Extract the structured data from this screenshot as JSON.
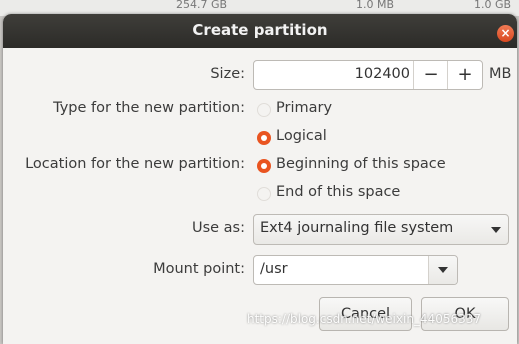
{
  "background": {
    "partition_size": "254.7 GB",
    "free_space": "1.0 MB",
    "right_text": "1.0 GB"
  },
  "dialog": {
    "title": "Create partition",
    "close_glyph": "×"
  },
  "size": {
    "label": "Size:",
    "value": "102400",
    "minus": "−",
    "plus": "+",
    "unit": "MB"
  },
  "type": {
    "label": "Type for the new partition:",
    "options": [
      {
        "label": "Primary",
        "selected": false
      },
      {
        "label": "Logical",
        "selected": true
      }
    ]
  },
  "location": {
    "label": "Location for the new partition:",
    "options": [
      {
        "label": "Beginning of this space",
        "selected": true
      },
      {
        "label": "End of this space",
        "selected": false
      }
    ]
  },
  "use_as": {
    "label": "Use as:",
    "value": "Ext4 journaling file system"
  },
  "mount_point": {
    "label": "Mount point:",
    "value": "/usr"
  },
  "buttons": {
    "cancel": "Cancel",
    "ok": "OK"
  },
  "watermark": "https://blog.csdn.net/weixin_44056337",
  "colors": {
    "accent": "#e95420",
    "titlebar": "#33322f",
    "dialog_bg": "#f4f3f1"
  }
}
